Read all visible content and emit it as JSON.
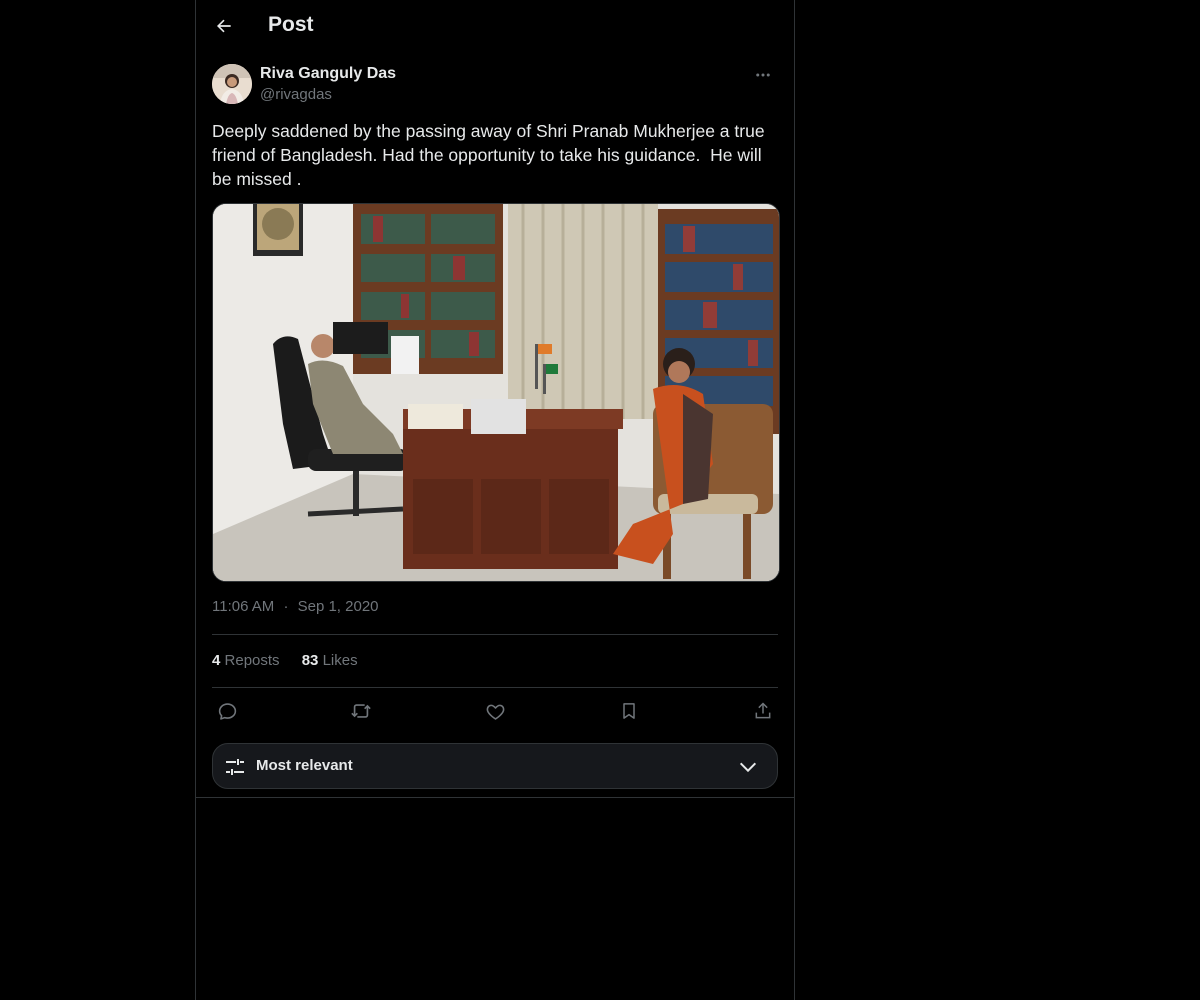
{
  "header": {
    "title": "Post"
  },
  "author": {
    "name": "Riva Ganguly Das",
    "handle": "@rivagdas"
  },
  "tweet": {
    "text": "Deeply saddened by the passing away of Shri Pranab Mukherjee a true\nfriend of Bangladesh. Had the opportunity to take his guidance.  He will\nbe missed .",
    "time": "11:06 AM",
    "separator": "·",
    "date": "Sep 1, 2020"
  },
  "stats": {
    "reposts_count": "4",
    "reposts_label": "Reposts",
    "likes_count": "83",
    "likes_label": "Likes"
  },
  "actions": {
    "icons": [
      "reply-icon",
      "repost-icon",
      "like-icon",
      "bookmark-icon",
      "share-icon"
    ]
  },
  "sort": {
    "label": "Most relevant"
  },
  "colors": {
    "background": "#000000",
    "text": "#e7e9ea",
    "muted": "#71767b",
    "border": "#2f3336"
  }
}
